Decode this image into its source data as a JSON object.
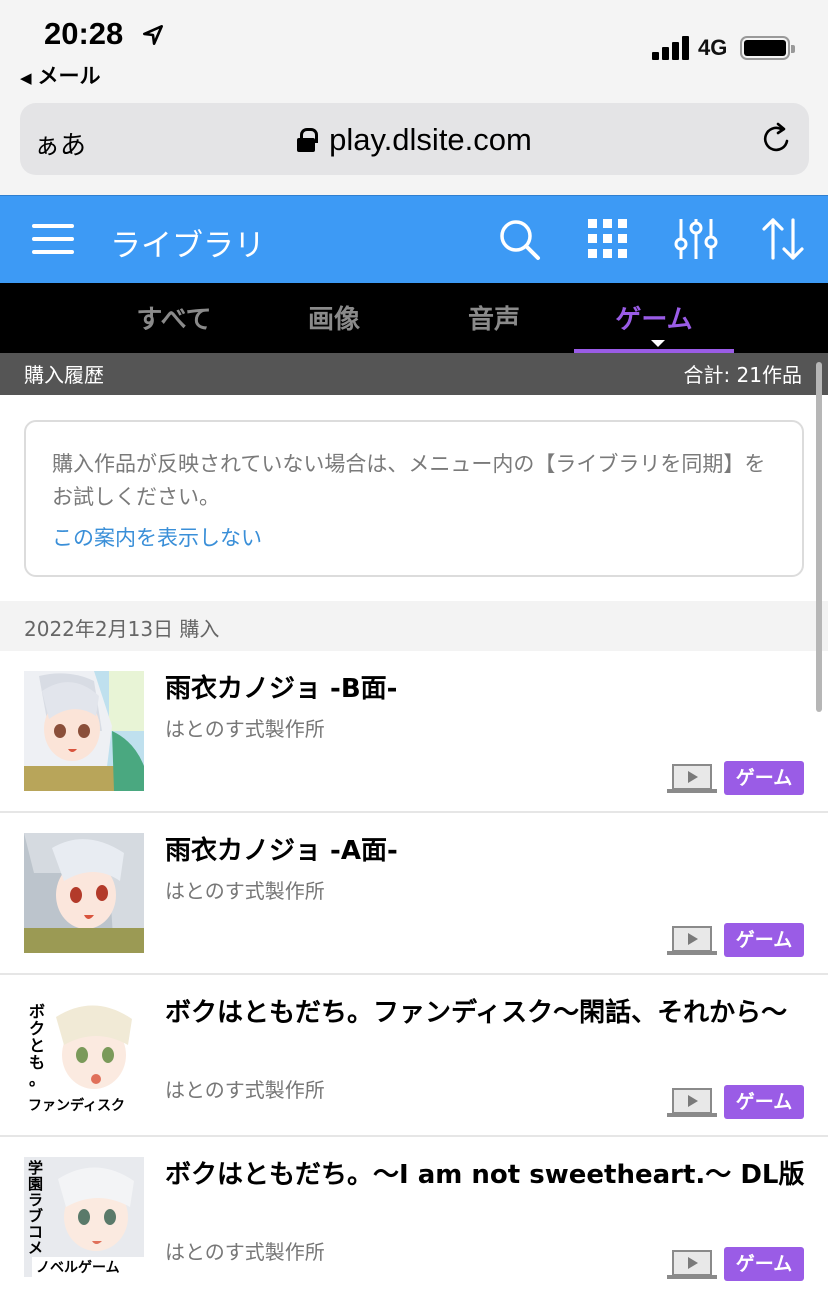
{
  "status_bar": {
    "time": "20:28",
    "back_app": "メール",
    "network": "4G"
  },
  "address_bar": {
    "text_size": "ぁあ",
    "url": "play.dlsite.com"
  },
  "header": {
    "title": "ライブラリ",
    "color": "#3d9af5"
  },
  "tabs": [
    {
      "label": "すべて",
      "active": false
    },
    {
      "label": "画像",
      "active": false
    },
    {
      "label": "音声",
      "active": false
    },
    {
      "label": "ゲーム",
      "active": true
    }
  ],
  "history": {
    "label": "購入履歴",
    "total": "合計: 21作品"
  },
  "notice": {
    "text": "購入作品が反映されていない場合は、メニュー内の【ライブラリを同期】をお試しください。",
    "link": "この案内を表示しない"
  },
  "date_group": "2022年2月13日 購入",
  "items": [
    {
      "title": "雨衣カノジョ -B面-",
      "maker": "はとのす式製作所",
      "tag": "ゲーム"
    },
    {
      "title": "雨衣カノジョ -A面-",
      "maker": "はとのす式製作所",
      "tag": "ゲーム"
    },
    {
      "title": "ボクはともだち。ファンディスク〜閑話、それから〜",
      "maker": "はとのす式製作所",
      "tag": "ゲーム",
      "thumb_text": "ボクとも。",
      "thumb_caption": "ファンディスク"
    },
    {
      "title": "ボクはともだち。〜I am not sweetheart.〜 DL版",
      "maker": "はとのす式製作所",
      "tag": "ゲーム",
      "thumb_text": "学園ラブコメ",
      "thumb_caption": "ノベルゲーム"
    }
  ],
  "accent": "#9a5ce6"
}
